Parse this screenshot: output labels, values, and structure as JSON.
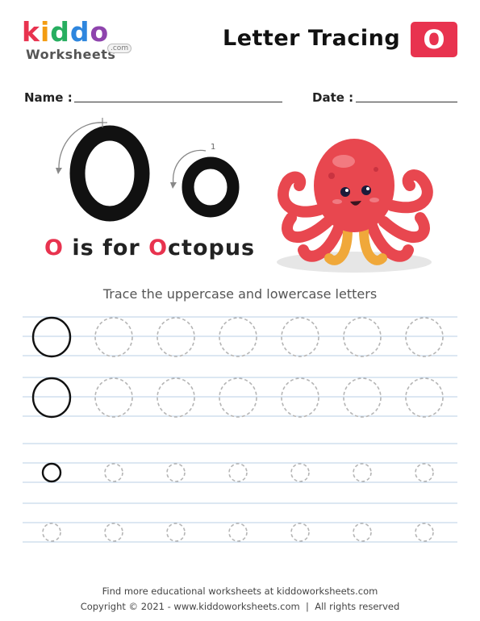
{
  "logo": {
    "brand_letters": [
      {
        "ch": "k",
        "color": "#e8334f"
      },
      {
        "ch": "i",
        "color": "#f39c12"
      },
      {
        "ch": "d",
        "color": "#27ae60"
      },
      {
        "ch": "d",
        "color": "#2e86de"
      },
      {
        "ch": "o",
        "color": "#8e44ad"
      }
    ],
    "subtitle": "Worksheets",
    "domain_badge": ".com"
  },
  "header": {
    "title": "Letter Tracing",
    "letter_badge": "O",
    "accent_color": "#e8334f"
  },
  "form": {
    "name_label": "Name :",
    "date_label": "Date :"
  },
  "display": {
    "uppercase": "O",
    "lowercase": "o",
    "uppercase_stroke_number": "1",
    "lowercase_stroke_number": "1"
  },
  "caption": {
    "letter": "O",
    "rest_1": " is for ",
    "letter_2": "O",
    "rest_2": "ctopus"
  },
  "illustration": "octopus",
  "instruction": "Trace the uppercase and lowercase letters",
  "tracing": {
    "per_row": 7,
    "uppercase_rows": 2,
    "lowercase_rows": 2,
    "first_solid": true
  },
  "footer": {
    "line1": "Find more educational worksheets at kiddoworksheets.com",
    "line2": "Copyright © 2021 - www.kiddoworksheets.com  |  All rights reserved"
  }
}
